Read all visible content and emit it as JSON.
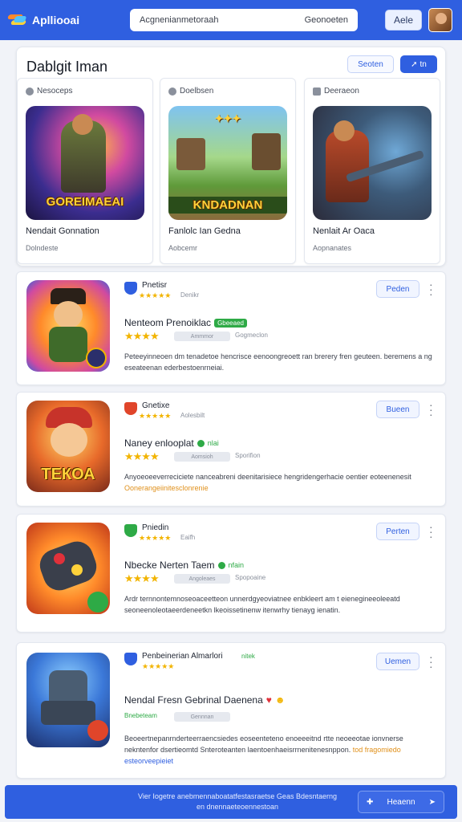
{
  "header": {
    "logo_text": "Aplliooai",
    "search_placeholder": "Acgnenianmetoraah",
    "search_hint": "Geonoeten",
    "help_label": "Aele"
  },
  "panel": {
    "title": "Dablgit Iman",
    "outline_button": "Seoten",
    "fill_button": "tn",
    "cards": [
      {
        "head": "Nesoceps",
        "art_label": "GOREIMAEAI",
        "title": "Nendait Gonnation",
        "sub": "Dolndeste"
      },
      {
        "head": "Doelbsen",
        "art_label": "KNDADNAN",
        "title": "Fanlolc Ian Gedna",
        "sub": "Aobcemr"
      },
      {
        "head": "Deeraeon",
        "art_label": "",
        "title": "Nenlait Ar Oaca",
        "sub": "Aopnanates"
      }
    ]
  },
  "apps": [
    {
      "publisher": "Pnetisr",
      "meta": "Denikr",
      "title": "Nenteom Prenoiklac",
      "badge": "Gbeeaed",
      "stars": "★★★★",
      "pill": "Ammmor",
      "meta2": "Gogmeclon",
      "desc": "Peteeyinneoen dm tenadetoe hencrisce eenoongreoett ran brerery fren geuteen. beremens a ng eseateenan ederbestoenrneiai.",
      "install": "Peden",
      "icon_text": ""
    },
    {
      "publisher": "Gnetixe",
      "meta": "Aolesbilt",
      "title": "Naney enlooplat",
      "badge": "nlai",
      "stars": "★★★★",
      "pill": "Aomsioh",
      "meta2": "Sporifion",
      "desc": "Anyoeoeeverreciciete nanceabreni deenitarisiece hengridengerhacie oentier eoteenenesit",
      "desc_hl": "Oonerangeiinitesclonrenie",
      "install": "Bueen",
      "icon_text": "ТЕКОА"
    },
    {
      "publisher": "Pniedin",
      "meta": "Eaifh",
      "title": "Nbecke Nerten Taem",
      "badge": "nfain",
      "stars": "★★★★",
      "pill": "Angoleaes",
      "meta2": "Spopoaine",
      "desc": "Ardr ternnontemnoseoaceetteon unnerdgyeoviatnee enbkleert am t eienegineeoleeatd seoneenoleotaeerdeneetkn lkeoissetinenw itenwrhy tienayg ienatin.",
      "install": "Perten",
      "icon_text": ""
    },
    {
      "publisher": "Penbeinerian Almarlori",
      "meta": "nitek",
      "title": "Nendal Fresn Gebrinal Daenena",
      "badge": "",
      "stars": "",
      "mini_text": "Bnebeteam",
      "pill": "Gennnan",
      "meta2": "",
      "desc": "Beoeertnepanrnderteerraencsiedes eoseenteteno enoeeeitnd rtte neoeeotae ionvnerse nekntenfor dsertieomtd Snteroteanten laentoenhaeisrrnenitenesnppon.",
      "desc_mid": "tod fragomiedo",
      "desc_hl": "esteorveepieiet",
      "install": "Uemen",
      "icon_text": ""
    }
  ],
  "bottom": {
    "text": "Vier Iogetre anebmennaboatatfestasraetse Geas Bdesntaerng en dnennaeteoennestoan",
    "button": "Heaenn"
  }
}
